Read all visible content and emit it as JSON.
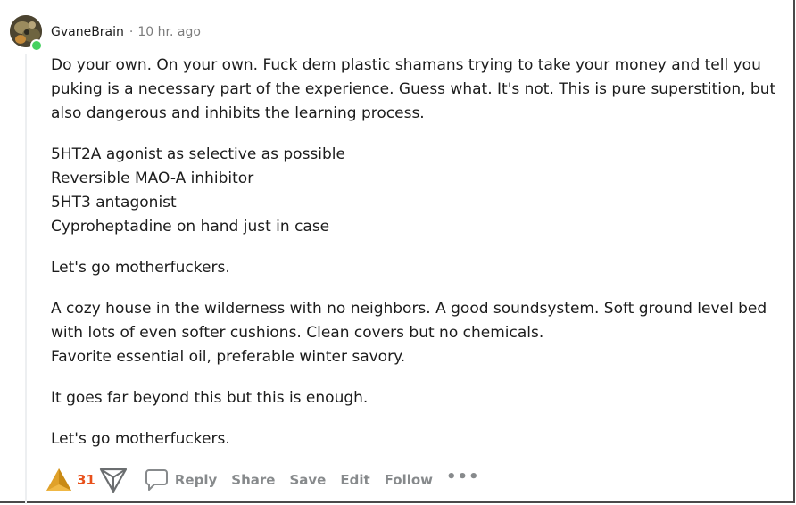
{
  "comment": {
    "author": "GvaneBrain",
    "separator": "·",
    "time": "10 hr. ago",
    "paragraphs": [
      "Do your own. On your own. Fuck dem plastic shamans trying to take your money and tell you puking is a necessary part of the experience. Guess what. It's not. This is pure superstition, but also dangerous and inhibits the learning process.",
      "5HT2A agonist as selective as possible\nReversible MAO-A inhibitor\n5HT3 antagonist\nCyproheptadine on hand just in case",
      "Let's go motherfuckers.",
      "A cozy house in the wilderness with no neighbors. A good soundsystem. Soft ground level bed with lots of even softer cushions. Clean covers but no chemicals.\nFavorite essential oil, preferable winter savory.",
      "It goes far beyond this but this is enough.",
      "Let's go motherfuckers."
    ]
  },
  "actions": {
    "score": "31",
    "reply": "Reply",
    "share": "Share",
    "save": "Save",
    "edit": "Edit",
    "follow": "Follow",
    "more": "•••"
  },
  "icons": {
    "upvote": "upvote-arrow-icon",
    "downvote": "downvote-arrow-icon",
    "reply": "speech-bubble-icon",
    "more": "ellipsis-icon"
  },
  "colors": {
    "upvote": "#e0a12a",
    "score": "#e8501a",
    "online": "#46d160",
    "muted": "#878a8c"
  }
}
